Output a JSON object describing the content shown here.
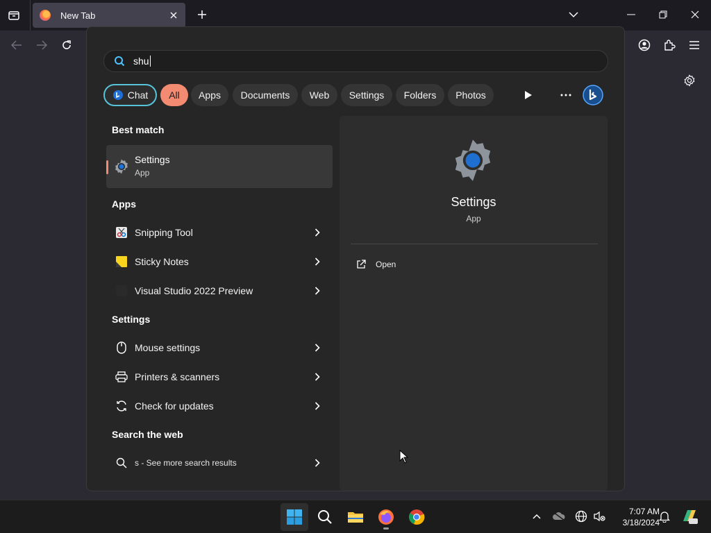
{
  "browser": {
    "tab_title": "New Tab"
  },
  "search": {
    "query": "shu"
  },
  "filters": {
    "chat": "Chat",
    "all": "All",
    "apps": "Apps",
    "documents": "Documents",
    "web": "Web",
    "settings": "Settings",
    "folders": "Folders",
    "photos": "Photos"
  },
  "results": {
    "best_match_title": "Best match",
    "best_match": {
      "name": "Settings",
      "type": "App"
    },
    "apps_title": "Apps",
    "apps": [
      "Snipping Tool",
      "Sticky Notes",
      "Visual Studio 2022 Preview"
    ],
    "settings_title": "Settings",
    "settings": [
      "Mouse settings",
      "Printers & scanners",
      "Check for updates"
    ],
    "web_title": "Search the web",
    "web": "s - See more search results"
  },
  "detail": {
    "name": "Settings",
    "type": "App",
    "open_label": "Open"
  },
  "taskbar": {
    "time": "7:07 AM",
    "date": "3/18/2024"
  },
  "colors": {
    "accent": "#f28b71",
    "chat_border": "#57c4d9",
    "win_blue": "#0ea5e9"
  }
}
